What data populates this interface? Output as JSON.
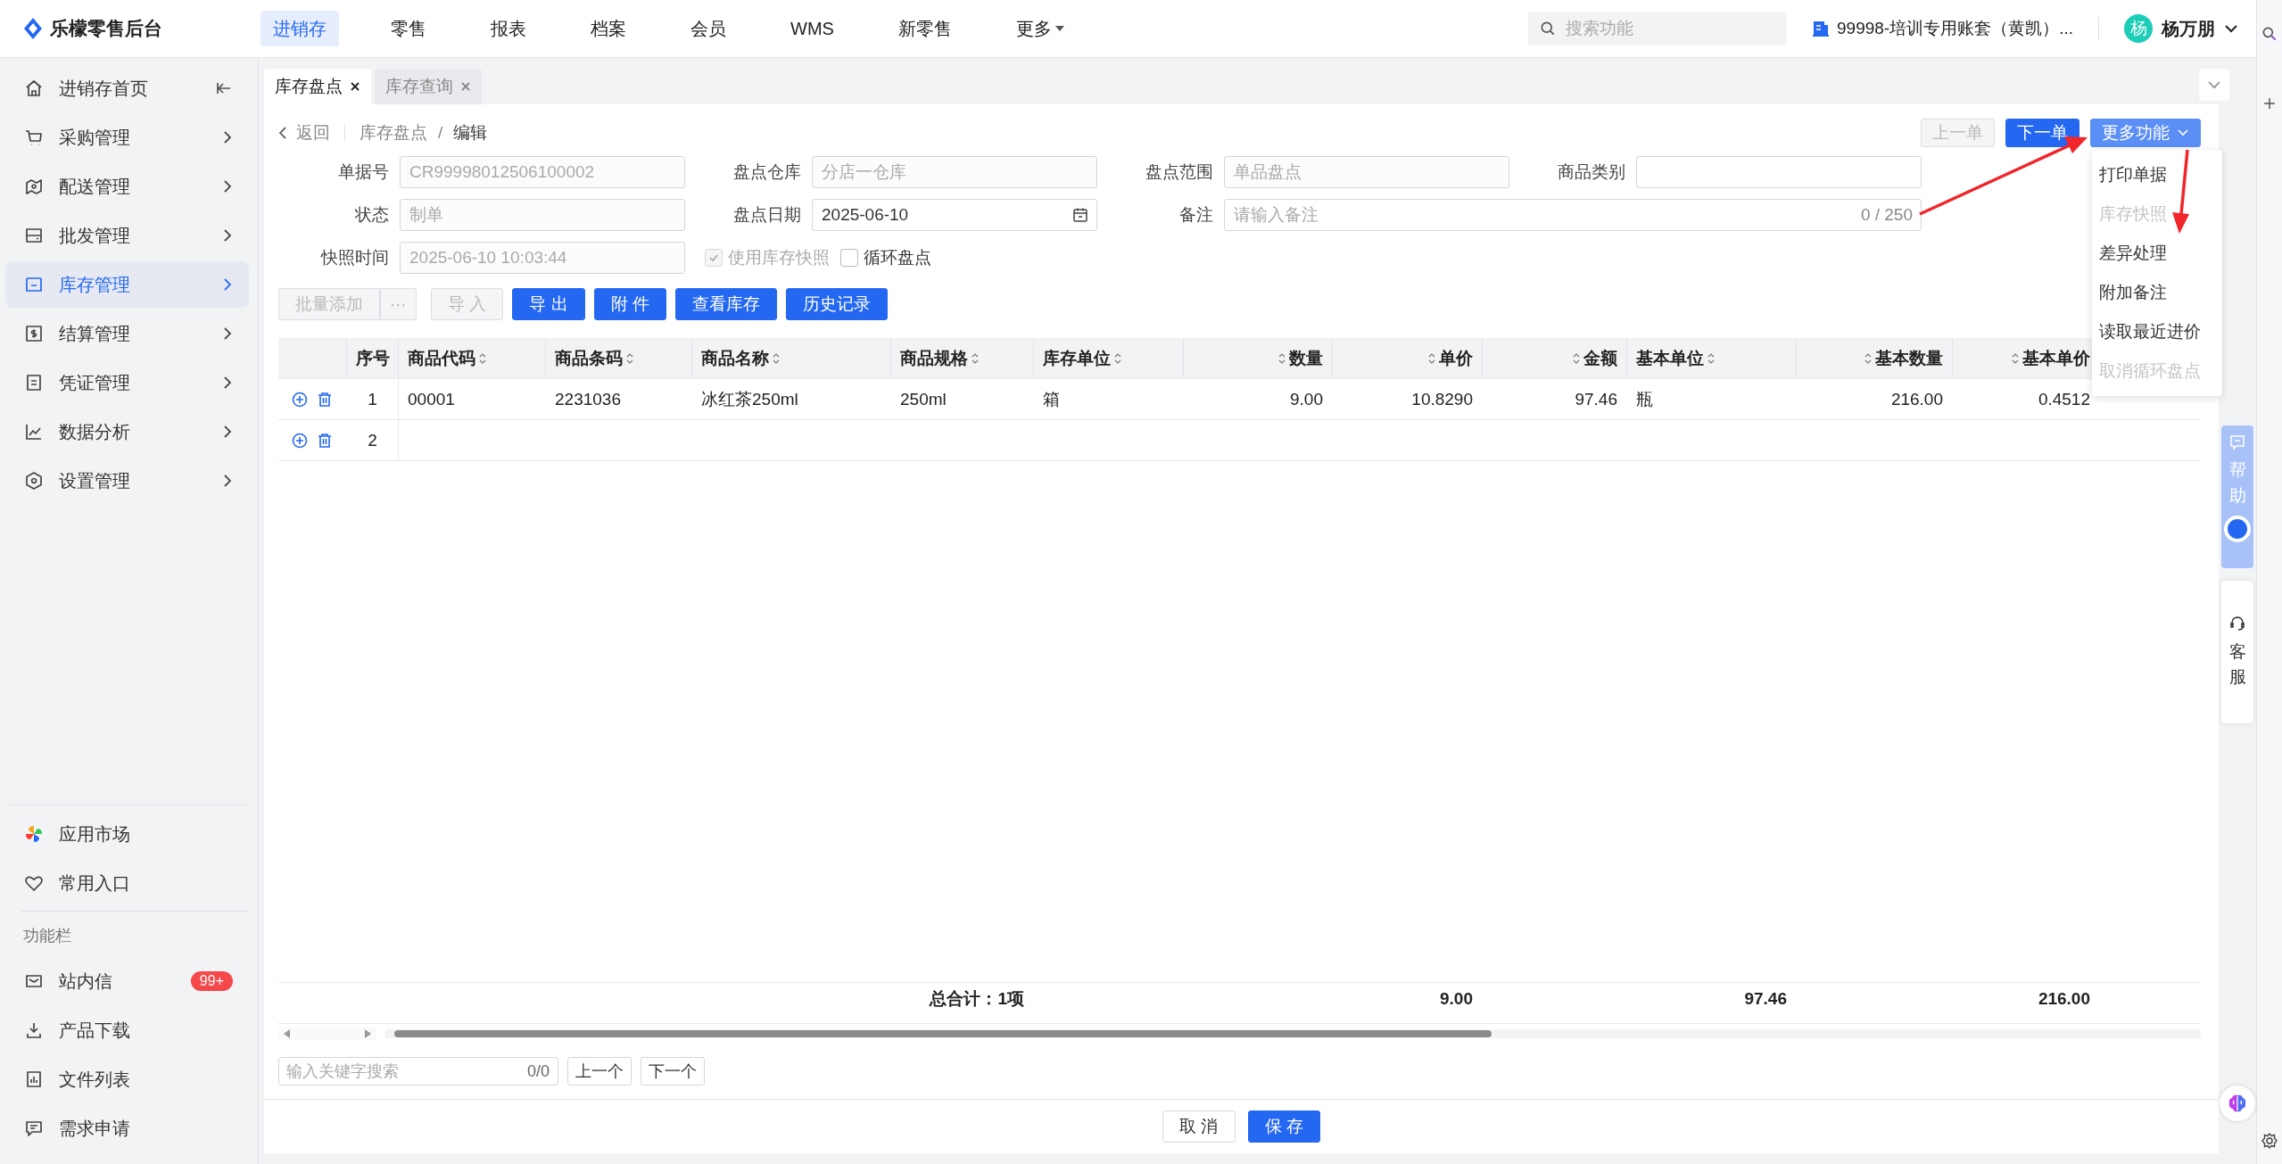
{
  "app": {
    "logo_text": "乐檬零售后台"
  },
  "top_nav": [
    {
      "label": "进销存",
      "selected": true,
      "kind": "link"
    },
    {
      "label": "零售",
      "selected": false,
      "kind": "link"
    },
    {
      "label": "报表",
      "selected": false,
      "kind": "link"
    },
    {
      "label": "档案",
      "selected": false,
      "kind": "link"
    },
    {
      "label": "会员",
      "selected": false,
      "kind": "link"
    },
    {
      "label": "WMS",
      "selected": false,
      "kind": "link"
    },
    {
      "label": "新零售",
      "selected": false,
      "kind": "link"
    },
    {
      "label": "更多",
      "selected": false,
      "kind": "dropdown"
    }
  ],
  "search": {
    "placeholder": "搜索功能"
  },
  "account": "99998-培训专用账套（黄凯）...",
  "user": {
    "avatar_char": "杨",
    "name": "杨万朋"
  },
  "sidebar": {
    "items": [
      {
        "label": "进销存首页",
        "selected": false,
        "kind": "home"
      },
      {
        "label": "采购管理",
        "selected": false,
        "kind": "menu"
      },
      {
        "label": "配送管理",
        "selected": false,
        "kind": "menu"
      },
      {
        "label": "批发管理",
        "selected": false,
        "kind": "menu"
      },
      {
        "label": "库存管理",
        "selected": true,
        "kind": "menu"
      },
      {
        "label": "结算管理",
        "selected": false,
        "kind": "menu"
      },
      {
        "label": "凭证管理",
        "selected": false,
        "kind": "menu"
      },
      {
        "label": "数据分析",
        "selected": false,
        "kind": "menu"
      },
      {
        "label": "设置管理",
        "selected": false,
        "kind": "menu"
      }
    ],
    "shortcuts": [
      {
        "label": "应用市场"
      },
      {
        "label": "常用入口"
      }
    ],
    "section_title": "功能栏",
    "tools": [
      {
        "label": "站内信",
        "badge": "99+"
      },
      {
        "label": "产品下载"
      },
      {
        "label": "文件列表"
      },
      {
        "label": "需求申请"
      }
    ]
  },
  "tabs": [
    {
      "label": "库存盘点",
      "selected": true
    },
    {
      "label": "库存查询",
      "selected": false
    }
  ],
  "breadcrumb": {
    "back": "返回",
    "path": "库存盘点",
    "separator": "/",
    "current": "编辑"
  },
  "record_nav": [
    {
      "label": "上一单",
      "disabled": true
    },
    {
      "label": "下一单",
      "disabled": false
    }
  ],
  "more_button": {
    "label": "更多功能",
    "expanded": true
  },
  "more_menu": [
    {
      "label": "打印单据",
      "disabled": false
    },
    {
      "label": "库存快照",
      "disabled": true
    },
    {
      "label": "差异处理",
      "disabled": false
    },
    {
      "label": "附加备注",
      "disabled": false
    },
    {
      "label": "读取最近进价",
      "disabled": false
    },
    {
      "label": "取消循环盘点",
      "disabled": true
    }
  ],
  "form": [
    {
      "label": "单据号",
      "value": "CR99998012506100002",
      "disabled": true,
      "kind": "text"
    },
    {
      "label": "盘点仓库",
      "value": "分店一仓库",
      "disabled": true,
      "kind": "text"
    },
    {
      "label": "盘点范围",
      "value": "单品盘点",
      "disabled": true,
      "kind": "text"
    },
    {
      "label": "商品类别",
      "kind": "text"
    },
    {
      "label": "状态",
      "value": "制单",
      "disabled": true,
      "kind": "text"
    },
    {
      "label": "盘点日期",
      "value": "2025-06-10",
      "disabled": false,
      "kind": "date"
    },
    {
      "label": "备注",
      "placeholder": "请输入备注",
      "counter": "0 / 250",
      "kind": "note"
    },
    {
      "label": "快照时间",
      "value": "2025-06-10 10:03:44",
      "disabled": true,
      "kind": "text"
    }
  ],
  "options": [
    {
      "label": "使用库存快照",
      "checked": true,
      "disabled": true
    },
    {
      "label": "循环盘点",
      "checked": false,
      "disabled": false
    }
  ],
  "actions": [
    {
      "label": "批量添加",
      "disabled": true,
      "kind": "plain"
    },
    {
      "label": "⋯",
      "disabled": true,
      "kind": "plain"
    },
    {
      "label": "导 入",
      "disabled": true,
      "kind": "plain"
    },
    {
      "label": "导 出",
      "disabled": false,
      "kind": "primary"
    },
    {
      "label": "附 件",
      "disabled": false,
      "kind": "primary"
    },
    {
      "label": "查看库存",
      "disabled": false,
      "kind": "primary"
    },
    {
      "label": "历史记录",
      "disabled": false,
      "kind": "primary"
    }
  ],
  "table": {
    "columns": [
      {
        "label": "序号",
        "sortable": false
      },
      {
        "label": "商品代码",
        "sortable": true
      },
      {
        "label": "商品条码",
        "sortable": true
      },
      {
        "label": "商品名称",
        "sortable": true
      },
      {
        "label": "商品规格",
        "sortable": true
      },
      {
        "label": "库存单位",
        "sortable": true
      },
      {
        "label": "数量",
        "sortable": true,
        "total": "9.00"
      },
      {
        "label": "单价",
        "sortable": true
      },
      {
        "label": "金额",
        "sortable": true,
        "total": "97.46"
      },
      {
        "label": "基本单位",
        "sortable": true
      },
      {
        "label": "基本数量",
        "sortable": true,
        "total": "216.00"
      },
      {
        "label": "基本单价",
        "sortable": true
      }
    ],
    "rows": [
      {
        "cells": [
          "1",
          "00001",
          "2231036",
          "冰红茶250ml",
          "250ml",
          "箱",
          "9.00",
          "10.8290",
          "97.46",
          "瓶",
          "216.00",
          "0.4512"
        ]
      },
      {
        "cells": [
          "2"
        ]
      }
    ],
    "totals": {
      "label": "总合计：1项"
    }
  },
  "find_bar": {
    "placeholder": "输入关键字搜索",
    "count": "0/0",
    "prev": "上一个",
    "next": "下一个"
  },
  "footer": [
    {
      "label": "取 消",
      "kind": "plain"
    },
    {
      "label": "保 存",
      "kind": "primary"
    }
  ],
  "side_widgets": [
    {
      "label": "帮助",
      "kind": "help"
    },
    {
      "label": "客服",
      "kind": "service"
    }
  ]
}
